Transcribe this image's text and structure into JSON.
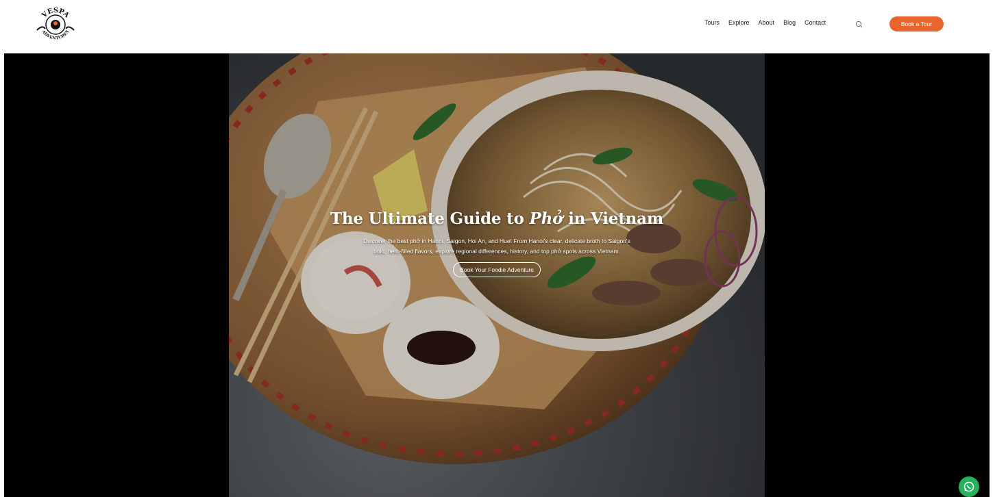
{
  "brand": {
    "logo_top_text": "VESPA",
    "logo_bottom_text": "ADVENTURES"
  },
  "nav": {
    "items": [
      "Tours",
      "Explore",
      "About",
      "Blog",
      "Contact"
    ]
  },
  "header": {
    "cta_label": "Book a Tour",
    "cta_color": "#e8662e",
    "search_icon": "search-icon"
  },
  "hero": {
    "title_before": "The Ultimate Guide to ",
    "title_emphasis": "Phở",
    "title_after": " in Vietnam",
    "description": "Discover the best phở in Hanoi, Saigon, Hoi An, and Hue! From Hanoi's clear, delicate broth to Saigon's bold, herb-filled flavors, explore regional differences, history, and top phở spots across Vietnam.",
    "button_label": "Book Your Foodie Adventure"
  },
  "floating": {
    "whatsapp_icon": "whatsapp-icon",
    "whatsapp_color": "#27b15d"
  }
}
